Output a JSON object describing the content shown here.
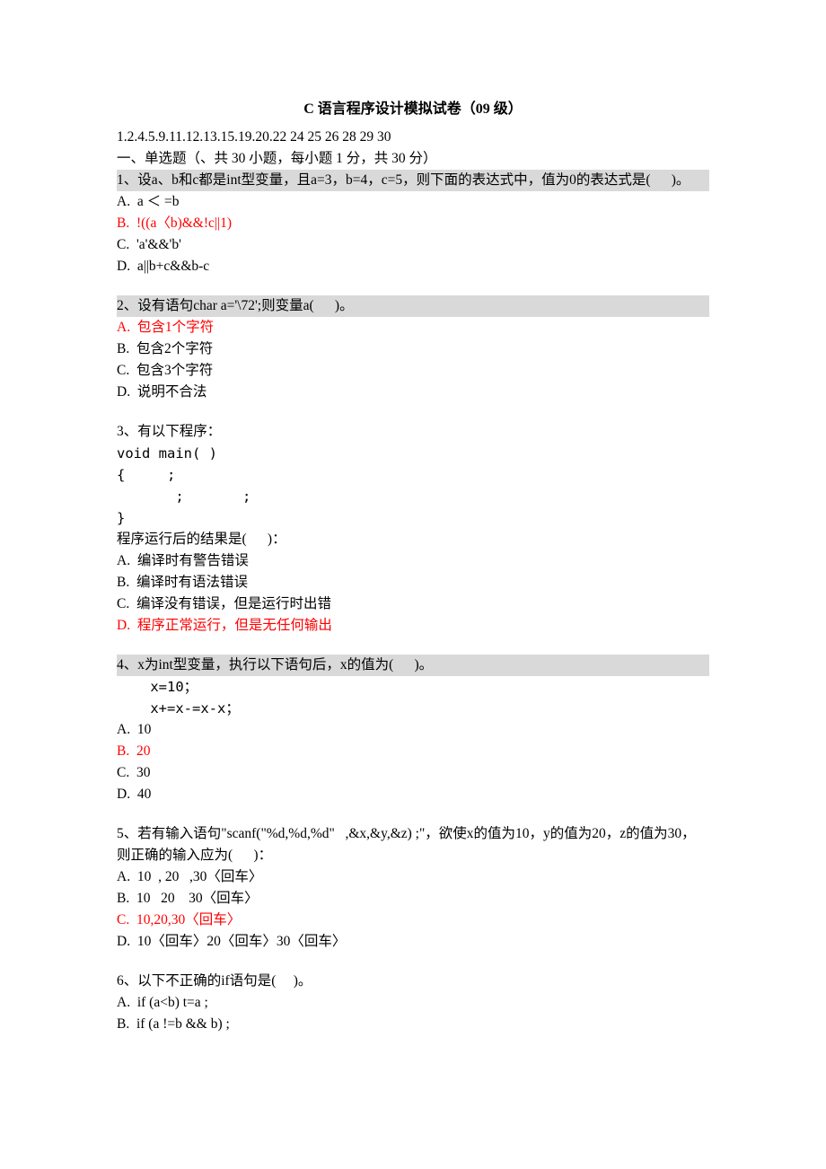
{
  "title": "C 语言程序设计模拟试卷（09 级）",
  "index_line": "1.2.4.5.9.11.12.13.15.19.20.22 24 25 26 28 29 30",
  "section_heading": "一、单选题（、共 30 小题，每小题 1 分，共 30 分）",
  "q1": {
    "stem_l1": "1、设a、b和c都是int型变量，且a=3，b=4，c=5，则下面的表达式中，值为0的表达式是(      )。",
    "A": "A.  a ＜ =b",
    "B": "B.  !((a〈b)&&!c||1)",
    "C": "C.  'a'&&'b'",
    "D": "D.  a||b+c&&b-c"
  },
  "q2": {
    "stem": "2、设有语句char a='\\72';则变量a(      )。",
    "A": "A.  包含1个字符",
    "B": "B.  包含2个字符",
    "C": "C.  包含3个字符",
    "D": "D.  说明不合法"
  },
  "q3": {
    "stem": "3、有以下程序：",
    "code1": "void main( )",
    "code2": "{     ;",
    "code3": "       ;       ;",
    "code4": "}",
    "after": "程序运行后的结果是(      )：",
    "A": "A.  编译时有警告错误",
    "B": "B.  编译时有语法错误",
    "C": "C.  编译没有错误，但是运行时出错",
    "D": "D.  程序正常运行，但是无任何输出"
  },
  "q4": {
    "stem": "4、x为int型变量，执行以下语句后，x的值为(      )。",
    "code1": "    x=10；",
    "code2": "    x+=x-=x-x；",
    "A": "A.  10",
    "B": "B.  20",
    "C": "C.  30",
    "D": "D.  40"
  },
  "q5": {
    "stem": "5、若有输入语句\"scanf(\"%d,%d,%d\"   ,&x,&y,&z) ;\"，欲使x的值为10，y的值为20，z的值为30，则正确的输入应为(      )：",
    "A": "A.  10  , 20   ,30〈回车〉",
    "B": "B.  10   20    30〈回车〉",
    "C": "C.  10,20,30〈回车〉",
    "D": "D.  10〈回车〉20〈回车〉30〈回车〉"
  },
  "q6": {
    "stem": "6、以下不正确的if语句是(     )。",
    "A": "A.  if (a<b) t=a ;",
    "B": "B.  if (a !=b && b) ;"
  }
}
